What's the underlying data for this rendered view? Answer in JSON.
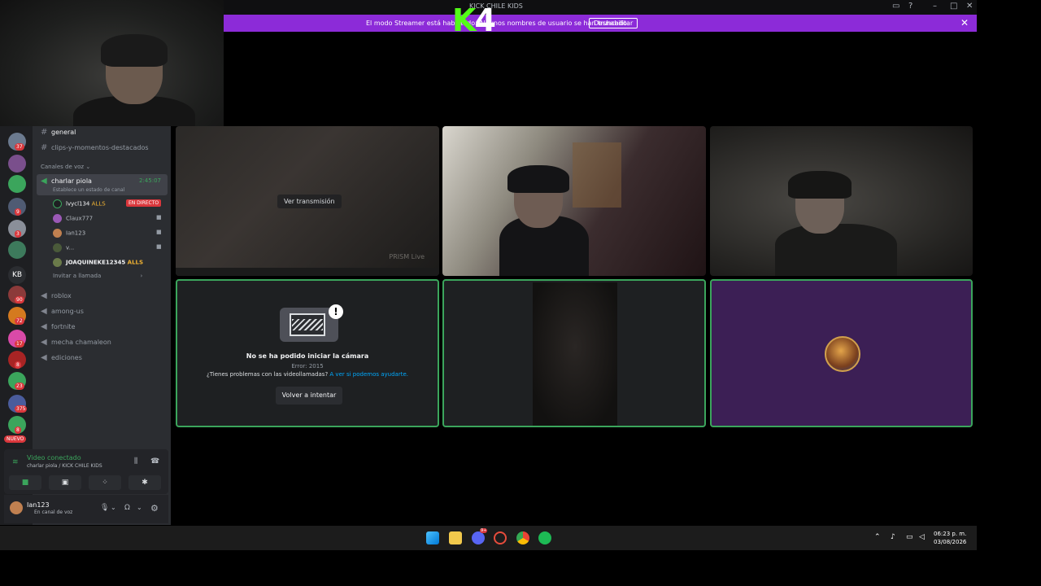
{
  "window": {
    "title": "KICK CHILE KIDS"
  },
  "overlay": {
    "k_letter": "K",
    "number": "4"
  },
  "banner": {
    "message": "El modo Streamer está habilitado. Algunos nombres de usuario se han truncado.",
    "button": "Deshabilitar"
  },
  "guilds": [
    {
      "badge": "37",
      "color": "#6b7a8f"
    },
    {
      "badge": "",
      "color": "#7a4f8c"
    },
    {
      "badge": "",
      "color": "#3ba55c"
    },
    {
      "badge": "9",
      "color": "#4f5b73"
    },
    {
      "badge": "3",
      "color": "#8a8f99"
    },
    {
      "badge": "",
      "color": "#3d7a5c"
    }
  ],
  "guilds_bottom": [
    {
      "badge": "90",
      "color": "#8c3a3a"
    },
    {
      "badge": "72",
      "color": "#d47a1f"
    },
    {
      "badge": "17",
      "color": "#d94aa8"
    },
    {
      "badge": "8",
      "color": "#a82424"
    },
    {
      "badge": "23",
      "color": "#3ba55c"
    },
    {
      "badge": "375",
      "color": "#4a5c9c"
    },
    {
      "badge": "8",
      "color": "#3ba55c"
    }
  ],
  "kb_label": "KB",
  "nuevo_label": "NUEVO",
  "channels": {
    "text": [
      {
        "name": "general"
      },
      {
        "name": "clips-y-momentos-destacados"
      }
    ],
    "voice_category": "Canales de voz",
    "active_voice": {
      "name": "charlar piola",
      "timer": "2:45:07",
      "status": "Establece un estado de canal"
    },
    "members": [
      {
        "name": "lvycl134",
        "tag": "ALLS",
        "live": "EN DIRECTO"
      },
      {
        "name": "Claux777"
      },
      {
        "name": "Ian123"
      },
      {
        "name": "v..."
      },
      {
        "name": "JOAQUINEKE12345",
        "tag": "ALLS"
      }
    ],
    "invite": "Invitar a llamada",
    "other_voice": [
      "roblox",
      "among-us",
      "fortnite",
      "mecha chamaleon",
      "ediciones"
    ]
  },
  "voice_panel": {
    "status": "Video conectado",
    "location": "charlar piola / KICK CHILE KIDS"
  },
  "user_panel": {
    "username": "Ian123",
    "status": "En canal de voz"
  },
  "tiles": {
    "stream_button": "Ver transmisión",
    "stream_watermark": "PRISM Live",
    "error_title": "No se ha podido iniciar la cámara",
    "error_code": "Error: 2015",
    "error_help": "¿Tienes problemas con las videollamadas?",
    "error_link": "A ver si podemos ayudarte.",
    "retry": "Volver a intentar"
  },
  "taskbar": {
    "time": "06:23 p. m.",
    "date": "03/08/2026",
    "discord_badge": "9+"
  }
}
